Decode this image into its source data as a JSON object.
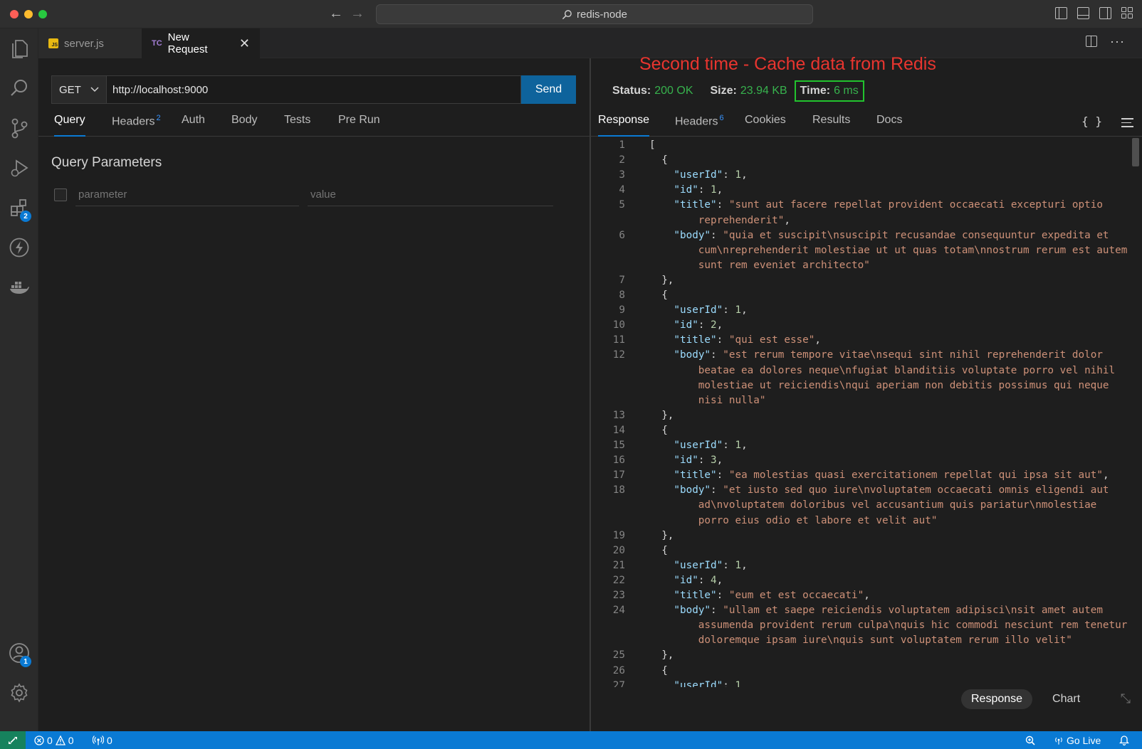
{
  "window": {
    "title": "redis-node"
  },
  "tabs": [
    {
      "label": "server.js",
      "badge": "JS"
    },
    {
      "label": "New Request",
      "badge": "TC"
    }
  ],
  "activity_badges": {
    "extensions": "2",
    "accounts": "1"
  },
  "request": {
    "method": "GET",
    "url": "http://localhost:9000",
    "send_label": "Send",
    "tabs": [
      {
        "label": "Query",
        "count": ""
      },
      {
        "label": "Headers",
        "count": "2"
      },
      {
        "label": "Auth",
        "count": ""
      },
      {
        "label": "Body",
        "count": ""
      },
      {
        "label": "Tests",
        "count": ""
      },
      {
        "label": "Pre Run",
        "count": ""
      }
    ],
    "query_title": "Query Parameters",
    "param_placeholder": "parameter",
    "value_placeholder": "value"
  },
  "annotation": "Second time - Cache data from Redis",
  "response": {
    "status_label": "Status:",
    "status_value": "200 OK",
    "size_label": "Size:",
    "size_value": "23.94 KB",
    "time_label": "Time:",
    "time_value": "6 ms",
    "tabs": [
      {
        "label": "Response",
        "count": ""
      },
      {
        "label": "Headers",
        "count": "6"
      },
      {
        "label": "Cookies",
        "count": ""
      },
      {
        "label": "Results",
        "count": ""
      },
      {
        "label": "Docs",
        "count": ""
      }
    ],
    "view_switch": {
      "response": "Response",
      "chart": "Chart"
    },
    "code_lines": [
      {
        "n": "1",
        "ln": true,
        "indent": 0,
        "parts": [
          [
            "p",
            "["
          ]
        ]
      },
      {
        "n": "2",
        "ln": true,
        "indent": 2,
        "parts": [
          [
            "p",
            "{"
          ]
        ]
      },
      {
        "n": "3",
        "ln": true,
        "indent": 4,
        "parts": [
          [
            "k",
            "\"userId\""
          ],
          [
            "p",
            ": "
          ],
          [
            "n",
            "1"
          ],
          [
            "p",
            ","
          ]
        ]
      },
      {
        "n": "4",
        "ln": true,
        "indent": 4,
        "parts": [
          [
            "k",
            "\"id\""
          ],
          [
            "p",
            ": "
          ],
          [
            "n",
            "1"
          ],
          [
            "p",
            ","
          ]
        ]
      },
      {
        "n": "5",
        "ln": true,
        "indent": 4,
        "parts": [
          [
            "k",
            "\"title\""
          ],
          [
            "p",
            ": "
          ],
          [
            "s",
            "\"sunt aut facere repellat provident occaecati excepturi optio"
          ]
        ]
      },
      {
        "n": "",
        "ln": false,
        "indent": 8,
        "parts": [
          [
            "s",
            "reprehenderit\""
          ],
          [
            "p",
            ","
          ]
        ]
      },
      {
        "n": "6",
        "ln": true,
        "indent": 4,
        "parts": [
          [
            "k",
            "\"body\""
          ],
          [
            "p",
            ": "
          ],
          [
            "s",
            "\"quia et suscipit\\nsuscipit recusandae consequuntur expedita et"
          ]
        ]
      },
      {
        "n": "",
        "ln": false,
        "indent": 8,
        "parts": [
          [
            "s",
            "cum\\nreprehenderit molestiae ut ut quas totam\\nnostrum rerum est autem"
          ]
        ]
      },
      {
        "n": "",
        "ln": false,
        "indent": 8,
        "parts": [
          [
            "s",
            "sunt rem eveniet architecto\""
          ]
        ]
      },
      {
        "n": "7",
        "ln": true,
        "indent": 2,
        "parts": [
          [
            "p",
            "},"
          ]
        ]
      },
      {
        "n": "8",
        "ln": true,
        "indent": 2,
        "parts": [
          [
            "p",
            "{"
          ]
        ]
      },
      {
        "n": "9",
        "ln": true,
        "indent": 4,
        "parts": [
          [
            "k",
            "\"userId\""
          ],
          [
            "p",
            ": "
          ],
          [
            "n",
            "1"
          ],
          [
            "p",
            ","
          ]
        ]
      },
      {
        "n": "10",
        "ln": true,
        "indent": 4,
        "parts": [
          [
            "k",
            "\"id\""
          ],
          [
            "p",
            ": "
          ],
          [
            "n",
            "2"
          ],
          [
            "p",
            ","
          ]
        ]
      },
      {
        "n": "11",
        "ln": true,
        "indent": 4,
        "parts": [
          [
            "k",
            "\"title\""
          ],
          [
            "p",
            ": "
          ],
          [
            "s",
            "\"qui est esse\""
          ],
          [
            "p",
            ","
          ]
        ]
      },
      {
        "n": "12",
        "ln": true,
        "indent": 4,
        "parts": [
          [
            "k",
            "\"body\""
          ],
          [
            "p",
            ": "
          ],
          [
            "s",
            "\"est rerum tempore vitae\\nsequi sint nihil reprehenderit dolor"
          ]
        ]
      },
      {
        "n": "",
        "ln": false,
        "indent": 8,
        "parts": [
          [
            "s",
            "beatae ea dolores neque\\nfugiat blanditiis voluptate porro vel nihil"
          ]
        ]
      },
      {
        "n": "",
        "ln": false,
        "indent": 8,
        "parts": [
          [
            "s",
            "molestiae ut reiciendis\\nqui aperiam non debitis possimus qui neque"
          ]
        ]
      },
      {
        "n": "",
        "ln": false,
        "indent": 8,
        "parts": [
          [
            "s",
            "nisi nulla\""
          ]
        ]
      },
      {
        "n": "13",
        "ln": true,
        "indent": 2,
        "parts": [
          [
            "p",
            "},"
          ]
        ]
      },
      {
        "n": "14",
        "ln": true,
        "indent": 2,
        "parts": [
          [
            "p",
            "{"
          ]
        ]
      },
      {
        "n": "15",
        "ln": true,
        "indent": 4,
        "parts": [
          [
            "k",
            "\"userId\""
          ],
          [
            "p",
            ": "
          ],
          [
            "n",
            "1"
          ],
          [
            "p",
            ","
          ]
        ]
      },
      {
        "n": "16",
        "ln": true,
        "indent": 4,
        "parts": [
          [
            "k",
            "\"id\""
          ],
          [
            "p",
            ": "
          ],
          [
            "n",
            "3"
          ],
          [
            "p",
            ","
          ]
        ]
      },
      {
        "n": "17",
        "ln": true,
        "indent": 4,
        "parts": [
          [
            "k",
            "\"title\""
          ],
          [
            "p",
            ": "
          ],
          [
            "s",
            "\"ea molestias quasi exercitationem repellat qui ipsa sit aut\""
          ],
          [
            "p",
            ","
          ]
        ]
      },
      {
        "n": "18",
        "ln": true,
        "indent": 4,
        "parts": [
          [
            "k",
            "\"body\""
          ],
          [
            "p",
            ": "
          ],
          [
            "s",
            "\"et iusto sed quo iure\\nvoluptatem occaecati omnis eligendi aut"
          ]
        ]
      },
      {
        "n": "",
        "ln": false,
        "indent": 8,
        "parts": [
          [
            "s",
            "ad\\nvoluptatem doloribus vel accusantium quis pariatur\\nmolestiae"
          ]
        ]
      },
      {
        "n": "",
        "ln": false,
        "indent": 8,
        "parts": [
          [
            "s",
            "porro eius odio et labore et velit aut\""
          ]
        ]
      },
      {
        "n": "19",
        "ln": true,
        "indent": 2,
        "parts": [
          [
            "p",
            "},"
          ]
        ]
      },
      {
        "n": "20",
        "ln": true,
        "indent": 2,
        "parts": [
          [
            "p",
            "{"
          ]
        ]
      },
      {
        "n": "21",
        "ln": true,
        "indent": 4,
        "parts": [
          [
            "k",
            "\"userId\""
          ],
          [
            "p",
            ": "
          ],
          [
            "n",
            "1"
          ],
          [
            "p",
            ","
          ]
        ]
      },
      {
        "n": "22",
        "ln": true,
        "indent": 4,
        "parts": [
          [
            "k",
            "\"id\""
          ],
          [
            "p",
            ": "
          ],
          [
            "n",
            "4"
          ],
          [
            "p",
            ","
          ]
        ]
      },
      {
        "n": "23",
        "ln": true,
        "indent": 4,
        "parts": [
          [
            "k",
            "\"title\""
          ],
          [
            "p",
            ": "
          ],
          [
            "s",
            "\"eum et est occaecati\""
          ],
          [
            "p",
            ","
          ]
        ]
      },
      {
        "n": "24",
        "ln": true,
        "indent": 4,
        "parts": [
          [
            "k",
            "\"body\""
          ],
          [
            "p",
            ": "
          ],
          [
            "s",
            "\"ullam et saepe reiciendis voluptatem adipisci\\nsit amet autem"
          ]
        ]
      },
      {
        "n": "",
        "ln": false,
        "indent": 8,
        "parts": [
          [
            "s",
            "assumenda provident rerum culpa\\nquis hic commodi nesciunt rem tenetur"
          ]
        ]
      },
      {
        "n": "",
        "ln": false,
        "indent": 8,
        "parts": [
          [
            "s",
            "doloremque ipsam iure\\nquis sunt voluptatem rerum illo velit\""
          ]
        ]
      },
      {
        "n": "25",
        "ln": true,
        "indent": 2,
        "parts": [
          [
            "p",
            "},"
          ]
        ]
      },
      {
        "n": "26",
        "ln": true,
        "indent": 2,
        "parts": [
          [
            "p",
            "{"
          ]
        ]
      },
      {
        "n": "27",
        "ln": true,
        "indent": 4,
        "parts": [
          [
            "k",
            "\"userId\""
          ],
          [
            "p",
            ": "
          ],
          [
            "n",
            "1"
          ]
        ]
      }
    ]
  },
  "statusbar": {
    "errors": "0",
    "warnings": "0",
    "ports": "0",
    "go_live": "Go Live"
  },
  "colors": {
    "accent": "#0a7ad4",
    "send_button": "#0e639c",
    "status_ok": "#37b24d",
    "annotation": "#e8352f",
    "time_box": "#22c32e"
  }
}
